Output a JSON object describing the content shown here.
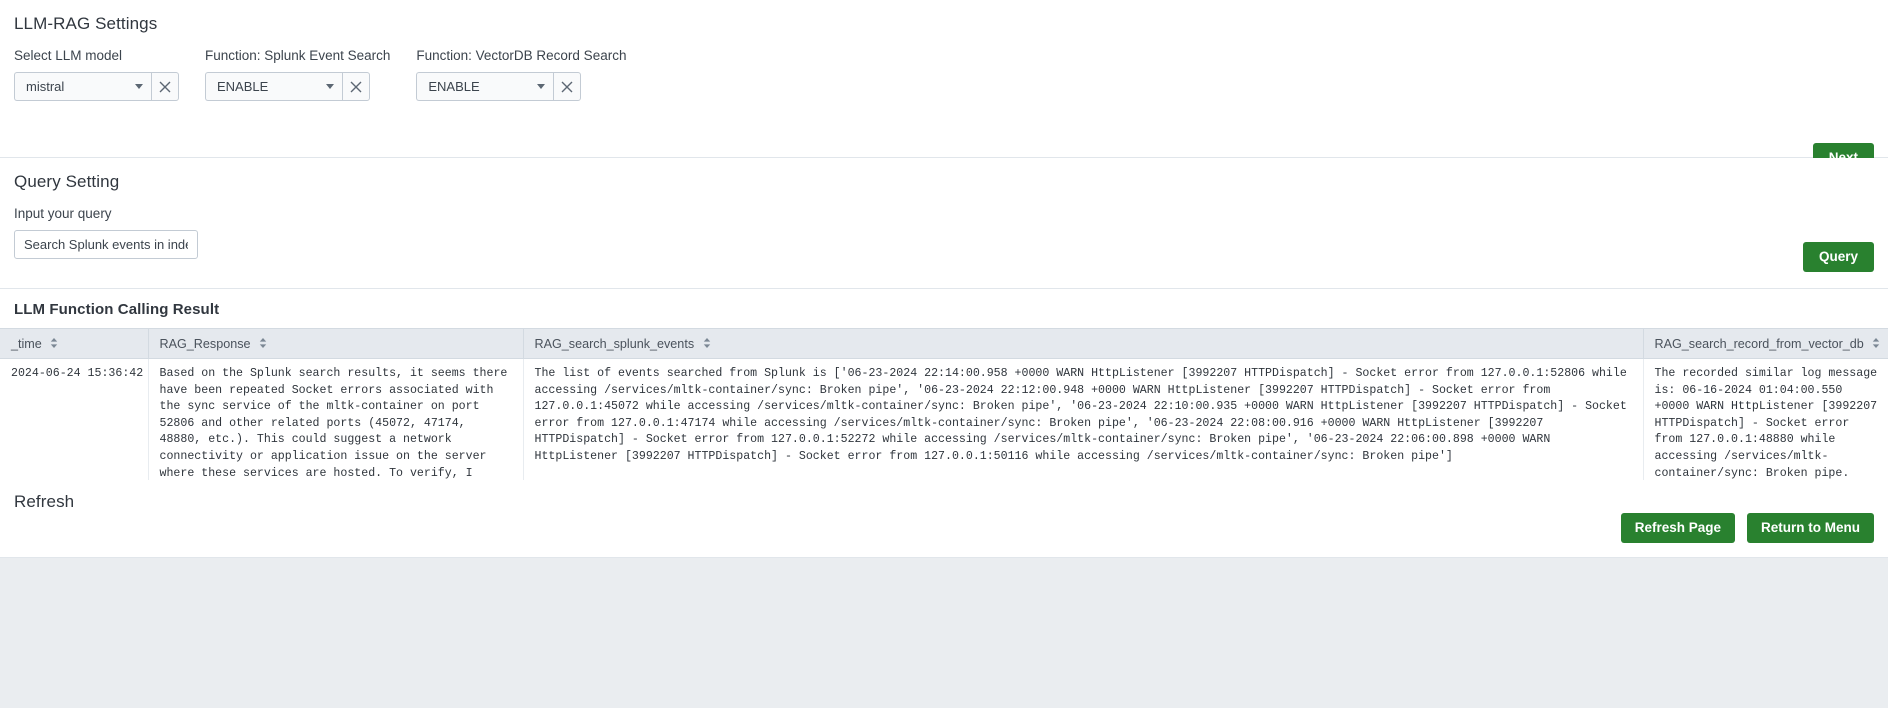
{
  "settings": {
    "title": "LLM-RAG Settings",
    "controls": [
      {
        "label": "Select LLM model",
        "value": "mistral",
        "name": "llm-model"
      },
      {
        "label": "Function: Splunk Event Search",
        "value": "ENABLE",
        "name": "splunk-event-search"
      },
      {
        "label": "Function: VectorDB Record Search",
        "value": "ENABLE",
        "name": "vectordb-record-search"
      }
    ],
    "next_label": "Next"
  },
  "query": {
    "title": "Query Setting",
    "input_label": "Input your query",
    "input_value": "Search Splunk events in index _i",
    "query_label": "Query"
  },
  "results": {
    "title": "LLM Function Calling Result",
    "columns": [
      {
        "key": "time",
        "label": "_time"
      },
      {
        "key": "resp",
        "label": "RAG_Response"
      },
      {
        "key": "splunk",
        "label": "RAG_search_splunk_events"
      },
      {
        "key": "vdb",
        "label": "RAG_search_record_from_vector_db"
      }
    ],
    "rows": [
      {
        "time": "2024-06-24 15:36:42",
        "resp": "Based on the Splunk search results, it seems there have been repeated Socket errors associated with the sync service of the mltk-container on port 52806 and other related ports (45072, 47174, 48880, etc.). This could suggest a network connectivity or application issue on the server where these services are hosted. To verify, I would recommend investigating both the networking configuration and the application's health status on that server.",
        "splunk": "The list of events searched from Splunk is ['06-23-2024 22:14:00.958 +0000 WARN  HttpListener [3992207 HTTPDispatch] - Socket error from 127.0.0.1:52806 while accessing /services/mltk-container/sync: Broken pipe', '06-23-2024 22:12:00.948 +0000 WARN  HttpListener [3992207 HTTPDispatch] - Socket error from 127.0.0.1:45072 while accessing /services/mltk-container/sync: Broken pipe', '06-23-2024 22:10:00.935 +0000 WARN  HttpListener [3992207 HTTPDispatch] - Socket error from 127.0.0.1:47174 while accessing /services/mltk-container/sync: Broken pipe', '06-23-2024 22:08:00.916 +0000 WARN  HttpListener [3992207 HTTPDispatch] - Socket error from 127.0.0.1:52272 while accessing /services/mltk-container/sync: Broken pipe', '06-23-2024 22:06:00.898 +0000 WARN  HttpListener [3992207 HTTPDispatch] - Socket error from 127.0.0.1:50116 while accessing /services/mltk-container/sync: Broken pipe']",
        "vdb": "The recorded similar log message is: 06-16-2024 01:04:00.550 +0000 WARN  HttpListener [3992207 HTTPDispatch] - Socket error from 127.0.0.1:48880 while accessing /services/mltk-container/sync: Broken pipe."
      }
    ]
  },
  "refresh": {
    "title": "Refresh",
    "refresh_page_label": "Refresh Page",
    "return_menu_label": "Return to Menu"
  },
  "colors": {
    "green_button": "#29812f",
    "highlight": "#4ad8b8",
    "header_bg": "#e5e9ee",
    "page_bg": "#eaedf0"
  }
}
